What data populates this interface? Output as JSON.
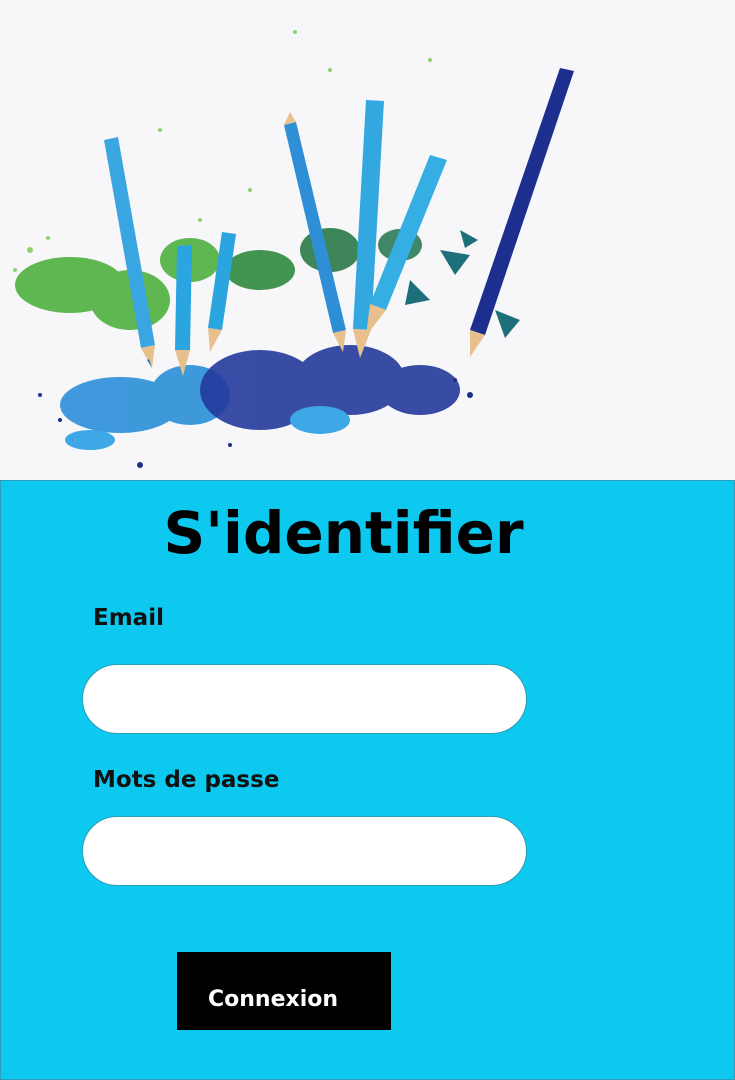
{
  "login": {
    "title": "S'identifier",
    "email_label": "Email",
    "email_value": "",
    "password_label": "Mots de passe",
    "password_value": "",
    "submit_label": "Connexion"
  },
  "colors": {
    "panel_background": "#0dc8ef",
    "button_background": "#000000",
    "button_text": "#ffffff",
    "input_background": "#ffffff"
  }
}
